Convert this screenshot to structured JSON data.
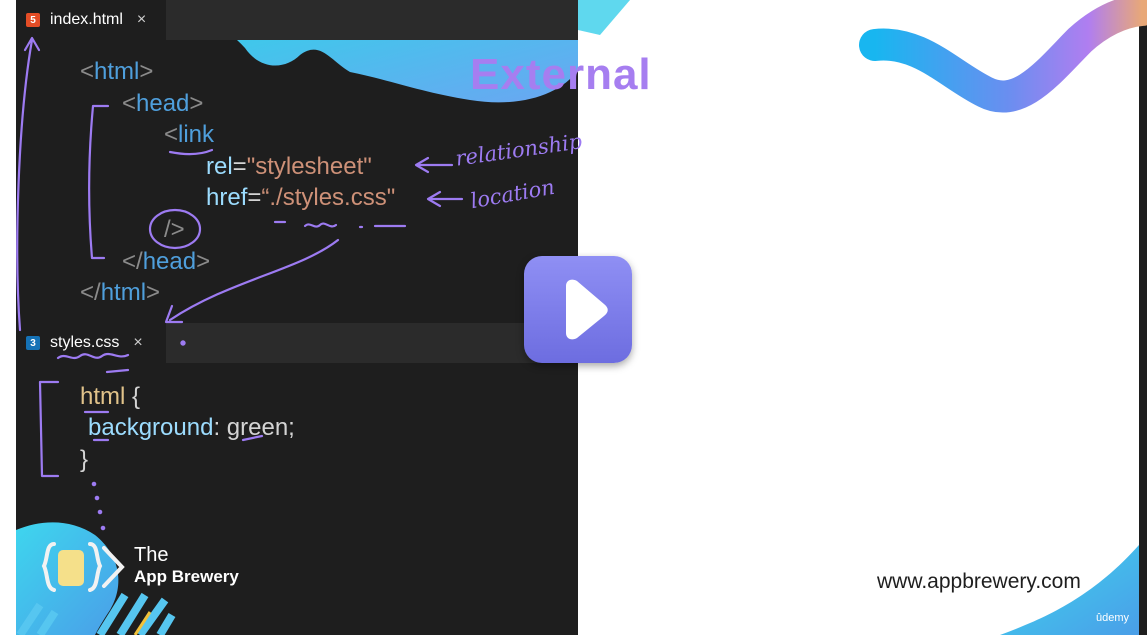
{
  "slide": {
    "title": "External",
    "website": "www.appbrewery.com",
    "watermark": "ûdemy",
    "brand": {
      "line1": "The",
      "line2": "App Brewery"
    }
  },
  "html_editor": {
    "tab": {
      "label": "index.html",
      "icon": "html5-icon",
      "icon_text": "5",
      "close": "×"
    },
    "lines": {
      "l1": {
        "open": "<",
        "tag": "html",
        "close": ">"
      },
      "l2": {
        "open": "<",
        "tag": "head",
        "close": ">"
      },
      "l3": {
        "open": "<",
        "tag": "link"
      },
      "l4": {
        "attr": "rel",
        "eq": "=",
        "value": "\"stylesheet\""
      },
      "l5": {
        "attr": "href",
        "eq": "=",
        "value": "“./styles.css\""
      },
      "l6": {
        "selfclose": "/>"
      },
      "l7": {
        "open": "</",
        "tag": "head",
        "close": ">"
      },
      "l8": {
        "open": "</",
        "tag": "html",
        "close": ">"
      }
    }
  },
  "css_editor": {
    "tab": {
      "label": "styles.css",
      "icon": "css3-icon",
      "icon_text": "3",
      "close": "×"
    },
    "lines": {
      "l1": {
        "selector": "html",
        "brace": " {"
      },
      "l2": {
        "property": "background",
        "colon": ": ",
        "value": "green;"
      },
      "l3": {
        "brace": "}"
      }
    }
  },
  "annotations": {
    "relationship": "relationship",
    "location": "location"
  },
  "colors": {
    "editor_bg": "#1e1e1e",
    "title_purple": "#a67ef0",
    "play_button": "#7b7be8",
    "annotation_purple": "#9d7bf2",
    "accent_cyan": "#38c8e8",
    "html5_orange": "#e44d26",
    "css3_blue": "#1572b6"
  },
  "icons": {
    "play": "play-icon",
    "logo": "app-brewery-logo-icon"
  }
}
